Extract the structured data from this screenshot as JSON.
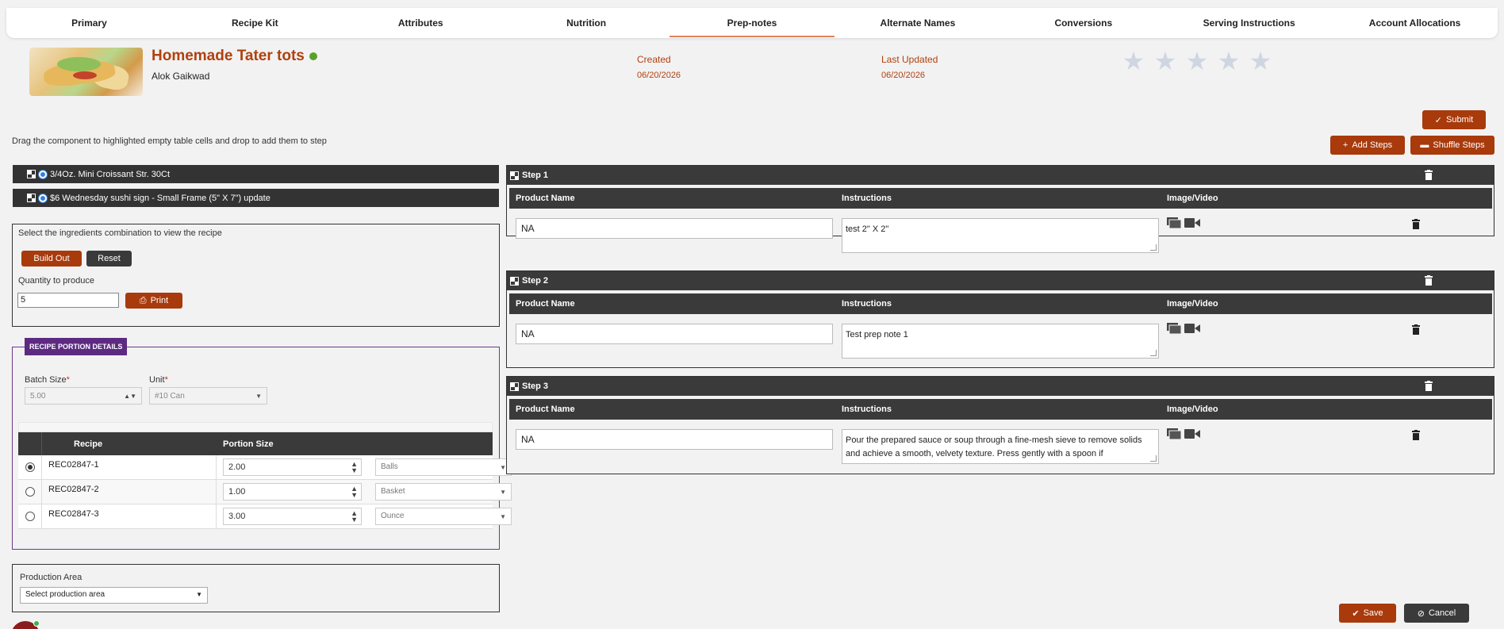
{
  "tabs": [
    "Primary",
    "Recipe Kit",
    "Attributes",
    "Nutrition",
    "Prep-notes",
    "Alternate Names",
    "Conversions",
    "Serving Instructions",
    "Account Allocations"
  ],
  "active_tab": "Prep-notes",
  "recipe": {
    "name": "Homemade Tater tots",
    "author": "Alok Gaikwad",
    "created_label": "Created",
    "created_date": "06/20/2026",
    "updated_label": "Last Updated",
    "updated_date": "06/20/2026",
    "rating": 0
  },
  "actions": {
    "submit": "Submit",
    "add_steps": "Add Steps",
    "shuffle_steps": "Shuffle Steps",
    "save": "Save",
    "cancel": "Cancel"
  },
  "instruction_text": "Drag the component to highlighted empty table cells and drop to add them to step",
  "components": [
    "3/4Oz. Mini Croissant Str. 30Ct",
    "$6 Wednesday sushi sign - Small Frame (5\" X 7\") update"
  ],
  "build": {
    "prompt": "Select the ingredients combination to view the recipe",
    "build_out": "Build Out",
    "reset": "Reset",
    "qty_label": "Quantity to produce",
    "qty_value": "5",
    "print": "Print"
  },
  "portion": {
    "legend": "RECIPE PORTION DETAILS",
    "batch_label": "Batch Size",
    "batch_value": "5.00",
    "unit_label": "Unit",
    "unit_value": "#10 Can",
    "col_recipe": "Recipe",
    "col_size": "Portion Size",
    "rows": [
      {
        "recipe": "REC02847-1",
        "size": "2.00",
        "unit": "Balls",
        "selected": true
      },
      {
        "recipe": "REC02847-2",
        "size": "1.00",
        "unit": "Basket",
        "selected": false
      },
      {
        "recipe": "REC02847-3",
        "size": "3.00",
        "unit": "Ounce",
        "selected": false
      }
    ]
  },
  "production": {
    "label": "Production Area",
    "placeholder": "Select production area"
  },
  "step_columns": {
    "product": "Product Name",
    "instructions": "Instructions",
    "media": "Image/Video"
  },
  "steps": [
    {
      "title": "Step 1",
      "product": "NA",
      "instructions": "test 2\" X 2\""
    },
    {
      "title": "Step 2",
      "product": "NA",
      "instructions": "Test prep note 1"
    },
    {
      "title": "Step 3",
      "product": "NA",
      "instructions": "Pour the prepared sauce or soup through a fine-mesh sieve to remove solids and achieve a smooth, velvety texture. Press gently with a spoon if"
    }
  ],
  "icons": {
    "drag": "drag-grid-icon",
    "trash": "trash-icon",
    "gallery": "gallery-icon",
    "video": "video-camera-icon",
    "check": "check-icon",
    "plus": "plus-icon",
    "shuffle": "shuffle-icon",
    "print": "printer-icon",
    "cancel": "ban-icon",
    "star": "star-icon"
  },
  "colors": {
    "accent": "#a83a0c",
    "dark": "#3a3a3a",
    "purple": "#5d2a82",
    "status": "#5aa02c",
    "star": "#cfd6e2"
  }
}
